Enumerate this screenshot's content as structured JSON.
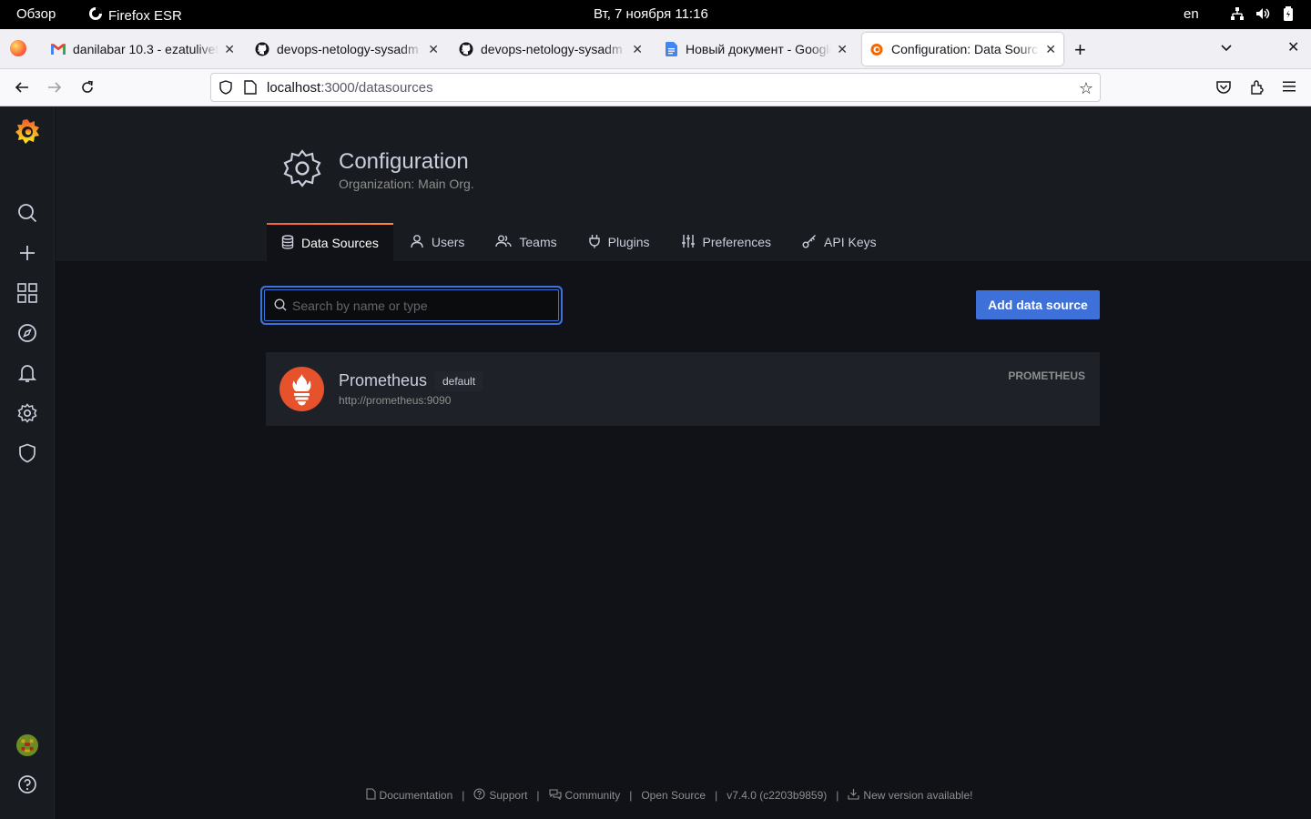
{
  "gnome": {
    "activities": "Обзор",
    "app_name": "Firefox ESR",
    "clock": "Вт, 7 ноября  11:16",
    "lang": "en"
  },
  "tabs": [
    {
      "label": "danilabar 10.3 - ezatulivet",
      "icon": "gmail-icon",
      "active": false
    },
    {
      "label": "devops-netology-sysadm",
      "icon": "github-icon",
      "active": false
    },
    {
      "label": "devops-netology-sysadm",
      "icon": "github-icon",
      "active": false
    },
    {
      "label": "Новый документ - Google",
      "icon": "google-docs-icon",
      "active": false
    },
    {
      "label": "Configuration: Data Sourc",
      "icon": "grafana-icon",
      "active": true
    }
  ],
  "url": {
    "host": "localhost",
    "path": ":3000/datasources"
  },
  "grafana": {
    "header": {
      "title": "Configuration",
      "subtitle": "Organization: Main Org."
    },
    "nav_tabs": [
      {
        "label": "Data Sources",
        "icon": "database-icon",
        "active": true
      },
      {
        "label": "Users",
        "icon": "user-icon",
        "active": false
      },
      {
        "label": "Teams",
        "icon": "users-icon",
        "active": false
      },
      {
        "label": "Plugins",
        "icon": "plug-icon",
        "active": false
      },
      {
        "label": "Preferences",
        "icon": "sliders-icon",
        "active": false
      },
      {
        "label": "API Keys",
        "icon": "key-icon",
        "active": false
      }
    ],
    "search": {
      "placeholder": "Search by name or type",
      "value": ""
    },
    "add_button": "Add data source",
    "datasources": [
      {
        "name": "Prometheus",
        "badge": "default",
        "url": "http://prometheus:9090",
        "type": "PROMETHEUS"
      }
    ],
    "footer": {
      "documentation": "Documentation",
      "support": "Support",
      "community": "Community",
      "open_source": "Open Source",
      "version": "v7.4.0 (c2203b9859)",
      "new_version": "New version available!",
      "separator": "|"
    }
  },
  "colors": {
    "accent": "#3d71d9",
    "grafana_orange": "#f55f3e",
    "prometheus": "#e6522c"
  }
}
